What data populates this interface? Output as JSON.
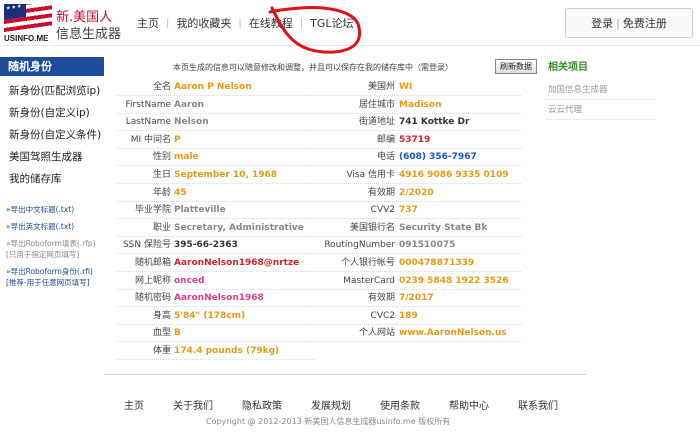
{
  "header": {
    "logo_sub": "USINFO.ME",
    "logo_title_line1": "新.美国人",
    "logo_title_line2": "信息生成器",
    "nav": [
      "主页",
      "我的收藏夹",
      "在线教程",
      "TGL论坛"
    ],
    "login_label": "登录",
    "register_label": "免费注册"
  },
  "sidebar": {
    "active": "随机身份",
    "items": [
      "新身份(匹配浏览ip)",
      "新身份(自定义ip)",
      "新身份(自定义条件)",
      "美国驾照生成器",
      "我的储存库"
    ],
    "exports": [
      {
        "text": "»导出中文标题(.txt)"
      },
      {
        "text": "»导出英文标题(.txt)"
      },
      {
        "text": "»导出Roboform填表(.rfp)",
        "note": "[只用于指定网页填写]"
      },
      {
        "text": "»导出Roboform身份(.rfi)",
        "note": "[推荐-用于任意网页填写]"
      }
    ]
  },
  "main": {
    "notice": "本页生成的信息可以随意修改和调整，并且可以保存在我的储存库中（需登录）",
    "refresh_label": "刷新数据",
    "left_fields": [
      {
        "label": "全名",
        "value": "Aaron P Nelson",
        "color": "orange"
      },
      {
        "label": "FirstName",
        "value": "Aaron",
        "color": "gray"
      },
      {
        "label": "LastName",
        "value": "Nelson",
        "color": "gray"
      },
      {
        "label": "MI 中间名",
        "value": "P",
        "color": "orange"
      },
      {
        "label": "性别",
        "value": "male",
        "color": "orange"
      },
      {
        "label": "生日",
        "value": "September  10,  1968",
        "color": "orange"
      },
      {
        "label": "年龄",
        "value": "45",
        "color": "orange"
      },
      {
        "label": "毕业学院",
        "value": "Platteville",
        "color": "gray"
      },
      {
        "label": "职业",
        "value": "Secretary, Administrative",
        "color": "gray"
      },
      {
        "label": "SSN 保险号",
        "value": "395-66-2363",
        "color": "dark"
      },
      {
        "label": "随机邮箱",
        "value": "AaronNelson1968@nrtze",
        "color": "red"
      },
      {
        "label": "网上昵称",
        "value": "onced",
        "color": "pink"
      },
      {
        "label": "随机密码",
        "value": "AaronNelson1968",
        "color": "pink"
      },
      {
        "label": "身高",
        "value": "5'84\" (178cm)",
        "color": "orange"
      },
      {
        "label": "血型",
        "value": "B",
        "color": "orange"
      },
      {
        "label": "体重",
        "value": "174.4 pounds (79kg)",
        "color": "orange"
      }
    ],
    "right_fields": [
      {
        "label": "美国州",
        "value": "WI",
        "color": "orange"
      },
      {
        "label": "居住城市",
        "value": "Madison",
        "color": "orange"
      },
      {
        "label": "街道地址",
        "value": "741 Kottke Dr",
        "color": "dark"
      },
      {
        "label": "邮编",
        "value": "53719",
        "color": "red"
      },
      {
        "label": "电话",
        "value": "(608) 356-7967",
        "color": "blue"
      },
      {
        "label": "Visa 信用卡",
        "value": "4916 9086 9335 0109",
        "color": "orange"
      },
      {
        "label": "有效期",
        "value": "2/2020",
        "color": "orange"
      },
      {
        "label": "CVV2",
        "value": "737",
        "color": "orange"
      },
      {
        "label": "美国银行名",
        "value": "Security State Bk",
        "color": "gray"
      },
      {
        "label": "RoutingNumber",
        "value": "091510075",
        "color": "gray"
      },
      {
        "label": "个人银行帐号",
        "value": "000478871339",
        "color": "orange"
      },
      {
        "label": "MasterCard",
        "value": "0239 5848 1922 3526",
        "color": "orange"
      },
      {
        "label": "有效期",
        "value": "7/2017",
        "color": "orange"
      },
      {
        "label": "CVC2",
        "value": "189",
        "color": "orange"
      },
      {
        "label": "个人网站",
        "value": "www.AaronNelson.us",
        "color": "orange"
      }
    ]
  },
  "related": {
    "title": "相关项目",
    "items": [
      "加国信息生成器",
      "云云代理"
    ]
  },
  "footer": {
    "links": [
      "主页",
      "关于我们",
      "隐私政策",
      "发展规划",
      "使用条款",
      "帮助中心",
      "联系我们"
    ],
    "copyright": "Copyright @ 2012-2013 新美国人信息生成器usinfo.me 版权所有"
  },
  "colors": {
    "accent": "#1e4b9b",
    "orange": "#e89a15",
    "red": "#d8212b",
    "annotation": "#e0101a"
  }
}
